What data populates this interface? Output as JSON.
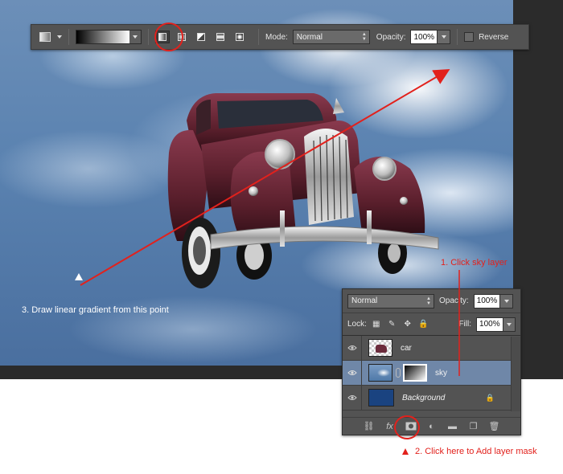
{
  "toolbar": {
    "mode_label": "Mode:",
    "mode_value": "Normal",
    "opacity_label": "Opacity:",
    "opacity_value": "100%",
    "reverse_label": "Reverse",
    "gradient_types": [
      "linear-gradient-icon",
      "radial-gradient-icon",
      "angle-gradient-icon",
      "reflected-gradient-icon",
      "diamond-gradient-icon"
    ],
    "active_gradient_type": "linear"
  },
  "layers_panel": {
    "blend_mode": "Normal",
    "opacity_label": "Opacity:",
    "opacity_value": "100%",
    "lock_label": "Lock:",
    "fill_label": "Fill:",
    "fill_value": "100%",
    "layers": [
      {
        "name": "car",
        "selected": false
      },
      {
        "name": "sky",
        "selected": true
      },
      {
        "name": "Background",
        "selected": false
      }
    ],
    "footer_icons": [
      "link-icon",
      "fx-icon",
      "add-layer-mask-icon",
      "adjustment-layer-icon",
      "group-folder-icon",
      "new-layer-icon",
      "trash-icon"
    ]
  },
  "annotations": {
    "step1": "1. Click  sky layer",
    "step2": "2. Click here to Add layer mask",
    "step3": "3. Draw linear gradient from this point"
  },
  "colors": {
    "annotation_red": "#e2211c",
    "panel_bg": "#535353",
    "selected_layer": "#6f87a8"
  }
}
